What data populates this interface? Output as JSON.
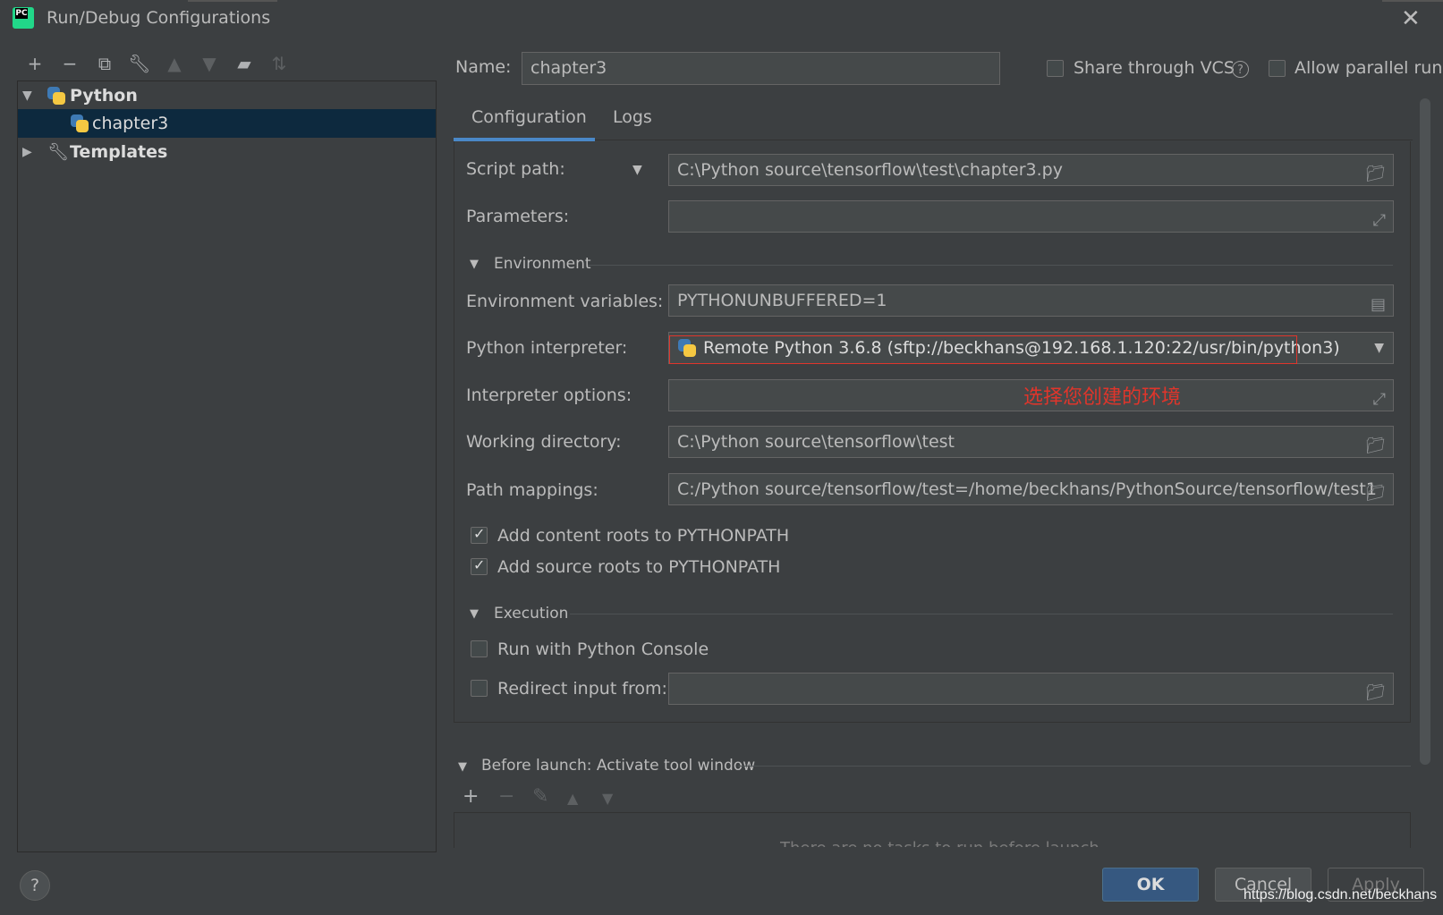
{
  "window": {
    "title": "Run/Debug Configurations",
    "logo_text": "PC"
  },
  "left_toolbar": {
    "icons": [
      "add-icon",
      "remove-icon",
      "copy-icon",
      "wrench-icon",
      "move-up-icon",
      "move-down-icon",
      "folder-add-icon",
      "sort-icon"
    ]
  },
  "tree": {
    "python_group": "Python",
    "chapter3": "chapter3",
    "templates": "Templates"
  },
  "header": {
    "name_label": "Name:",
    "name_value": "chapter3",
    "share_vcs": "Share through VCS",
    "allow_parallel": "Allow parallel run",
    "help_glyph": "?"
  },
  "tabs": [
    "Configuration",
    "Logs"
  ],
  "config": {
    "script_path_label": "Script path:",
    "script_path_value": "C:\\Python source\\tensorflow\\test\\chapter3.py",
    "parameters_label": "Parameters:",
    "parameters_value": "",
    "environment_section": "Environment",
    "env_vars_label": "Environment variables:",
    "env_vars_value": "PYTHONUNBUFFERED=1",
    "interpreter_label": "Python interpreter:",
    "interpreter_value": "Remote Python 3.6.8 (sftp://beckhans@192.168.1.120:22/usr/bin/python3)",
    "interpreter_options_label": "Interpreter options:",
    "interpreter_options_value": "",
    "annotation": "选择您创建的环境",
    "working_dir_label": "Working directory:",
    "working_dir_value": "C:\\Python source\\tensorflow\\test",
    "path_mappings_label": "Path mappings:",
    "path_mappings_value": "C:/Python source/tensorflow/test=/home/beckhans/PythonSource/tensorflow/test1",
    "add_content_roots": "Add content roots to PYTHONPATH",
    "add_source_roots": "Add source roots to PYTHONPATH",
    "execution_section": "Execution",
    "run_with_console": "Run with Python Console",
    "redirect_input": "Redirect input from:",
    "redirect_input_value": ""
  },
  "before_launch": {
    "title": "Before launch: Activate tool window",
    "empty_text": "There are no tasks to run before launch"
  },
  "buttons": {
    "ok": "OK",
    "cancel": "Cancel",
    "apply": "Apply",
    "help": "?"
  },
  "watermark": "https://blog.csdn.net/beckhans",
  "colors": {
    "background": "#3c3f41",
    "selection": "#0d293e",
    "accent": "#4a88c7",
    "ok_button": "#365880",
    "annotation": "#e0352b"
  }
}
